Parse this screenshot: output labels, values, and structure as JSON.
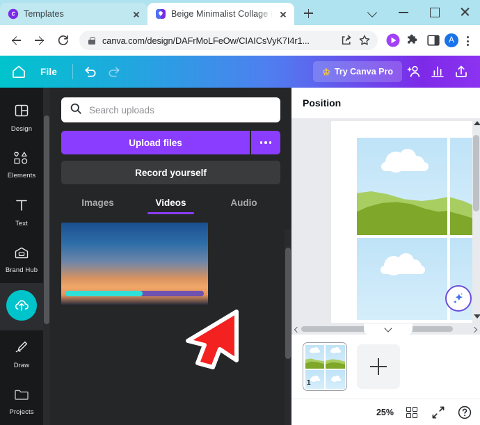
{
  "browser": {
    "tabs": [
      {
        "title": "Templates",
        "favicon": "canva-logo-icon",
        "active": false
      },
      {
        "title": "Beige Minimalist Collage Ins",
        "favicon": "canva-logo-icon",
        "active": true
      }
    ],
    "new_tab_label": "+",
    "window_controls": [
      "tab-search-chevron",
      "minimize",
      "maximize",
      "close"
    ],
    "nav": {
      "back": "back-arrow-icon",
      "forward": "forward-arrow-icon",
      "reload": "reload-icon"
    },
    "omnibox": {
      "url": "canva.com/design/DAFrMoLFeOw/CIAICsVyK7I4r1...",
      "lock": "lock-icon",
      "share": "share-icon",
      "bookmark": "star-icon"
    },
    "toolbar_icons": [
      "media-play-icon",
      "extensions-puzzle-icon",
      "side-panel-icon"
    ],
    "profile_initial": "A",
    "menu": "kebab-menu-icon"
  },
  "canva_header": {
    "home_icon": "home-icon",
    "file_label": "File",
    "undo_icon": "undo-icon",
    "redo_icon": "redo-icon",
    "pro_label": "Try Canva Pro",
    "crown_icon": "crown-icon",
    "collaborate_icon": "add-collaborator-icon",
    "insights_icon": "insights-chart-icon",
    "share_icon": "share-upload-icon",
    "gradient_start": "#00c4cc",
    "gradient_end": "#8b33f0"
  },
  "sidebar": {
    "items": [
      {
        "label": "Design",
        "icon": "design-layout-icon",
        "active": false
      },
      {
        "label": "Elements",
        "icon": "elements-shapes-icon",
        "active": false
      },
      {
        "label": "Text",
        "icon": "text-t-icon",
        "active": false
      },
      {
        "label": "Brand Hub",
        "icon": "brand-hub-icon",
        "active": false
      },
      {
        "label": "",
        "icon": "uploads-cloud-icon",
        "active": true
      },
      {
        "label": "Draw",
        "icon": "draw-pen-icon",
        "active": false
      },
      {
        "label": "Projects",
        "icon": "projects-folder-icon",
        "active": false
      }
    ],
    "active_accent": "#00c4cc"
  },
  "uploads_panel": {
    "search": {
      "placeholder": "Search uploads",
      "value": "",
      "icon": "search-icon"
    },
    "upload_button": "Upload files",
    "upload_more_icon": "more-options-icon",
    "record_button": "Record yourself",
    "tabs": [
      {
        "label": "Images",
        "selected": false
      },
      {
        "label": "Videos",
        "selected": true
      },
      {
        "label": "Audio",
        "selected": false
      }
    ],
    "tab_accent": "#8b3dff",
    "upload_accent": "#8b3dff",
    "video_item": {
      "name": "sunset-video-thumbnail",
      "progress_percent": 56,
      "progress_color": "#2ee0d8"
    },
    "collapse_handle": "collapse-panel-icon"
  },
  "right_panel": {
    "position_label": "Position"
  },
  "canvas": {
    "magic_button": "magic-sparkle-icon",
    "scroll_up": "scroll-up-arrow",
    "scroll_down": "scroll-down-arrow",
    "hscroll_left": "scroll-left-arrow",
    "hscroll_right": "scroll-right-arrow",
    "sky_color": "#bfe3f7",
    "hill_light": "#a8ce62",
    "hill_dark": "#7fa82b"
  },
  "pages": {
    "collapse_icon": "chevron-down-icon",
    "items": [
      {
        "number": "1"
      }
    ],
    "add_page_icon": "add-page-icon"
  },
  "bottom_bar": {
    "zoom": "25%",
    "grid_icon": "grid-view-icon",
    "fullscreen_icon": "fullscreen-expand-icon",
    "help_icon": "help-question-icon"
  },
  "cursor": {
    "name": "mouse-pointer-arrow"
  }
}
